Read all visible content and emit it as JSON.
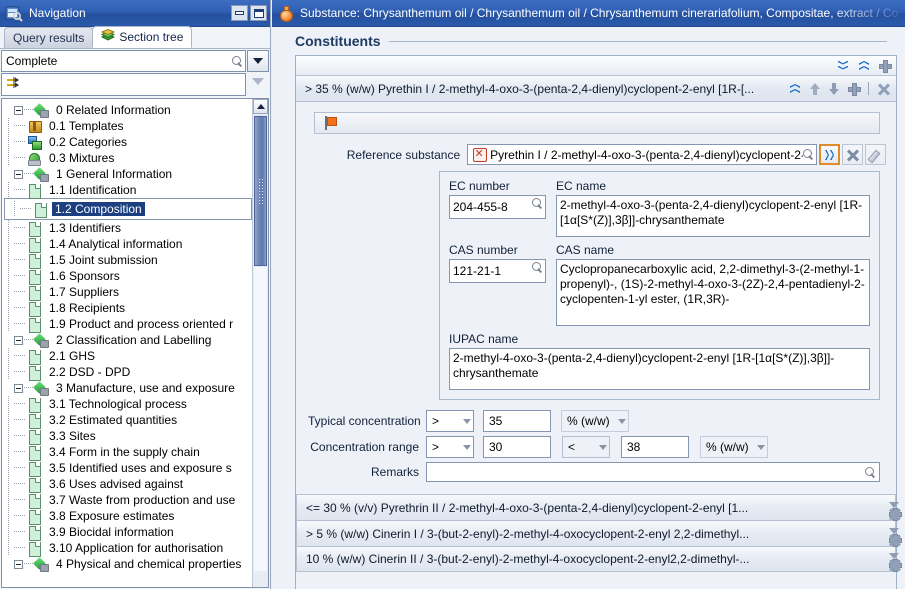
{
  "navigation": {
    "title": "Navigation",
    "title_icon": "navigation-window-icon",
    "window_buttons": [
      {
        "name": "minimize",
        "glyph": "minimize-icon"
      },
      {
        "name": "maximize",
        "glyph": "maximize-icon"
      }
    ],
    "tabs": [
      {
        "label": "Query results",
        "active": false,
        "icon": ""
      },
      {
        "label": "Section tree",
        "active": true,
        "icon": "stack-icon"
      }
    ],
    "search": {
      "value": "Complete",
      "placeholder": "",
      "icon": "search-icon",
      "dropdown_icon": "chevron-down-icon"
    },
    "filter": {
      "value": "",
      "placeholder": "",
      "icon": "filter-jump-icon",
      "side_icon": "triangle-down-outline-icon"
    },
    "tree": [
      {
        "label": "0 Related Information",
        "level": 0,
        "icon": "green-node-icon",
        "expander": "minus",
        "selected": false
      },
      {
        "label": "0.1 Templates",
        "level": 1,
        "icon": "box-icon",
        "expander": "none",
        "selected": false
      },
      {
        "label": "0.2 Categories",
        "level": 1,
        "icon": "categories-icon",
        "expander": "none",
        "selected": false
      },
      {
        "label": "0.3 Mixtures",
        "level": 1,
        "icon": "mixtures-icon",
        "expander": "none",
        "selected": false
      },
      {
        "label": "1 General Information",
        "level": 0,
        "icon": "green-node-icon",
        "expander": "minus",
        "selected": false
      },
      {
        "label": "1.1 Identification",
        "level": 1,
        "icon": "document-icon",
        "expander": "none",
        "selected": false
      },
      {
        "label": "1.2 Composition",
        "level": 1,
        "icon": "document-icon",
        "expander": "none",
        "selected": true
      },
      {
        "label": "1.3 Identifiers",
        "level": 1,
        "icon": "document-icon",
        "expander": "none",
        "selected": false
      },
      {
        "label": "1.4 Analytical information",
        "level": 1,
        "icon": "document-icon",
        "expander": "none",
        "selected": false
      },
      {
        "label": "1.5 Joint submission",
        "level": 1,
        "icon": "document-icon",
        "expander": "none",
        "selected": false
      },
      {
        "label": "1.6 Sponsors",
        "level": 1,
        "icon": "document-icon",
        "expander": "none",
        "selected": false
      },
      {
        "label": "1.7 Suppliers",
        "level": 1,
        "icon": "document-icon",
        "expander": "none",
        "selected": false
      },
      {
        "label": "1.8 Recipients",
        "level": 1,
        "icon": "document-icon",
        "expander": "none",
        "selected": false
      },
      {
        "label": "1.9 Product and process oriented r",
        "level": 1,
        "icon": "document-icon",
        "expander": "none",
        "selected": false
      },
      {
        "label": "2 Classification and Labelling",
        "level": 0,
        "icon": "green-node-icon",
        "expander": "minus",
        "selected": false
      },
      {
        "label": "2.1 GHS",
        "level": 1,
        "icon": "document-icon",
        "expander": "none",
        "selected": false
      },
      {
        "label": "2.2 DSD - DPD",
        "level": 1,
        "icon": "document-icon",
        "expander": "none",
        "selected": false
      },
      {
        "label": "3 Manufacture, use and exposure",
        "level": 0,
        "icon": "green-node-icon",
        "expander": "minus",
        "selected": false
      },
      {
        "label": "3.1 Technological process",
        "level": 1,
        "icon": "document-icon",
        "expander": "none",
        "selected": false
      },
      {
        "label": "3.2 Estimated quantities",
        "level": 1,
        "icon": "document-icon",
        "expander": "none",
        "selected": false
      },
      {
        "label": "3.3 Sites",
        "level": 1,
        "icon": "document-icon",
        "expander": "none",
        "selected": false
      },
      {
        "label": "3.4 Form in the supply chain",
        "level": 1,
        "icon": "document-icon",
        "expander": "none",
        "selected": false
      },
      {
        "label": "3.5 Identified uses and exposure s",
        "level": 1,
        "icon": "document-icon",
        "expander": "none",
        "selected": false
      },
      {
        "label": "3.6 Uses advised against",
        "level": 1,
        "icon": "document-icon",
        "expander": "none",
        "selected": false
      },
      {
        "label": "3.7 Waste from production and use",
        "level": 1,
        "icon": "document-icon",
        "expander": "none",
        "selected": false
      },
      {
        "label": "3.8 Exposure estimates",
        "level": 1,
        "icon": "document-icon",
        "expander": "none",
        "selected": false
      },
      {
        "label": "3.9 Biocidal information",
        "level": 1,
        "icon": "document-icon",
        "expander": "none",
        "selected": false
      },
      {
        "label": "3.10 Application for authorisation",
        "level": 1,
        "icon": "document-icon",
        "expander": "none",
        "selected": false
      },
      {
        "label": "4 Physical and chemical properties",
        "level": 0,
        "icon": "green-node-icon",
        "expander": "minus",
        "selected": false
      }
    ]
  },
  "document": {
    "titlebar": {
      "icon": "flask-icon",
      "text": "Substance: Chrysanthemum oil / Chrysanthemum oil / Chrysanthemum cinerariafolium, Compositae, extract / Co"
    },
    "section_title": "Constituents",
    "panel_toolbar": [
      {
        "name": "expand-all-icon",
        "glyph": "double-chevron-down"
      },
      {
        "name": "collapse-all-icon",
        "glyph": "double-chevron-up"
      },
      {
        "name": "add-block-icon",
        "glyph": "plus"
      }
    ],
    "expanded_block": {
      "header": "> 35 % (w/w) Pyrethin I / 2-methyl-4-oxo-3-(penta-2,4-dienyl)cyclopent-2-enyl [1R-[...",
      "header_icons": [
        {
          "name": "collapse-icon",
          "glyph": "double-chevron-up"
        },
        {
          "name": "move-up-icon",
          "glyph": "arrow-up"
        },
        {
          "name": "move-down-icon",
          "glyph": "arrow-down"
        },
        {
          "name": "add-icon",
          "glyph": "plus"
        },
        {
          "name": "delete-icon",
          "glyph": "cross"
        }
      ],
      "flag_bar": {
        "icon": "orange-flag-icon",
        "value": ""
      },
      "reference_substance": {
        "label": "Reference substance",
        "icon": "reference-substance-icon",
        "value": "Pyrethin I / 2-methyl-4-oxo-3-(penta-2,4-dienyl)cyclopent-2-",
        "search_icon": "search-icon",
        "buttons": [
          {
            "name": "open-reference-button",
            "glyph": "double-chevron-right",
            "focused": true,
            "enabled": true
          },
          {
            "name": "clear-reference-button",
            "glyph": "cross",
            "enabled": false
          },
          {
            "name": "edit-reference-button",
            "glyph": "pencil",
            "enabled": false
          }
        ]
      },
      "identity": {
        "ec_number_label": "EC number",
        "ec_number_value": "204-455-8",
        "ec_name_label": "EC name",
        "ec_name_value": "2-methyl-4-oxo-3-(penta-2,4-dienyl)cyclopent-2-enyl [1R-[1α[S*(Z)],3β]]-chrysanthemate",
        "cas_number_label": "CAS number",
        "cas_number_value": "121-21-1",
        "cas_name_label": "CAS name",
        "cas_name_value": "Cyclopropanecarboxylic acid, 2,2-dimethyl-3-(2-methyl-1-propenyl)-, (1S)-2-methyl-4-oxo-3-(2Z)-2,4-pentadienyl-2-cyclopenten-1-yl ester, (1R,3R)-",
        "iupac_name_label": "IUPAC name",
        "iupac_name_value": "2-methyl-4-oxo-3-(penta-2,4-dienyl)cyclopent-2-enyl [1R-[1α[S*(Z)],3β]]-chrysanthemate"
      },
      "typical_concentration": {
        "label": "Typical concentration",
        "operator": ">",
        "value": "35",
        "unit": "% (w/w)"
      },
      "concentration_range": {
        "label": "Concentration range",
        "lower_operator": ">",
        "lower_value": "30",
        "upper_operator": "<",
        "upper_value": "38",
        "unit": "% (w/w)"
      },
      "remarks": {
        "label": "Remarks",
        "value": "",
        "icon": "search-icon"
      }
    },
    "collapsed_blocks": [
      {
        "header": "<= 30 % (v/v) Pyrethrin II / 2-methyl-4-oxo-3-(penta-2,4-dienyl)cyclopent-2-enyl [1...",
        "icons": [
          "double-chevron-down",
          "arrow-up",
          "arrow-down",
          "plus",
          "cross"
        ]
      },
      {
        "header": "> 5 % (w/w) Cinerin I / 3-(but-2-enyl)-2-methyl-4-oxocyclopent-2-enyl 2,2-dimethyl...",
        "icons": [
          "double-chevron-down",
          "arrow-up",
          "arrow-down",
          "plus",
          "cross"
        ]
      },
      {
        "header": "10 % (w/w) Cinerin II / 3-(but-2-enyl)-2-methyl-4-oxocyclopent-2-enyl2,2-dimethyl-...",
        "icons": [
          "double-chevron-down",
          "arrow-up",
          "arrow-down",
          "plus",
          "cross"
        ]
      }
    ]
  },
  "colors": {
    "titlebar_blue": "#2f5fb4",
    "accent_blue": "#1769c8",
    "selection_blue": "#1b3f80",
    "panel_bg": "#eef2f8",
    "focus_orange": "#e08b2a"
  }
}
